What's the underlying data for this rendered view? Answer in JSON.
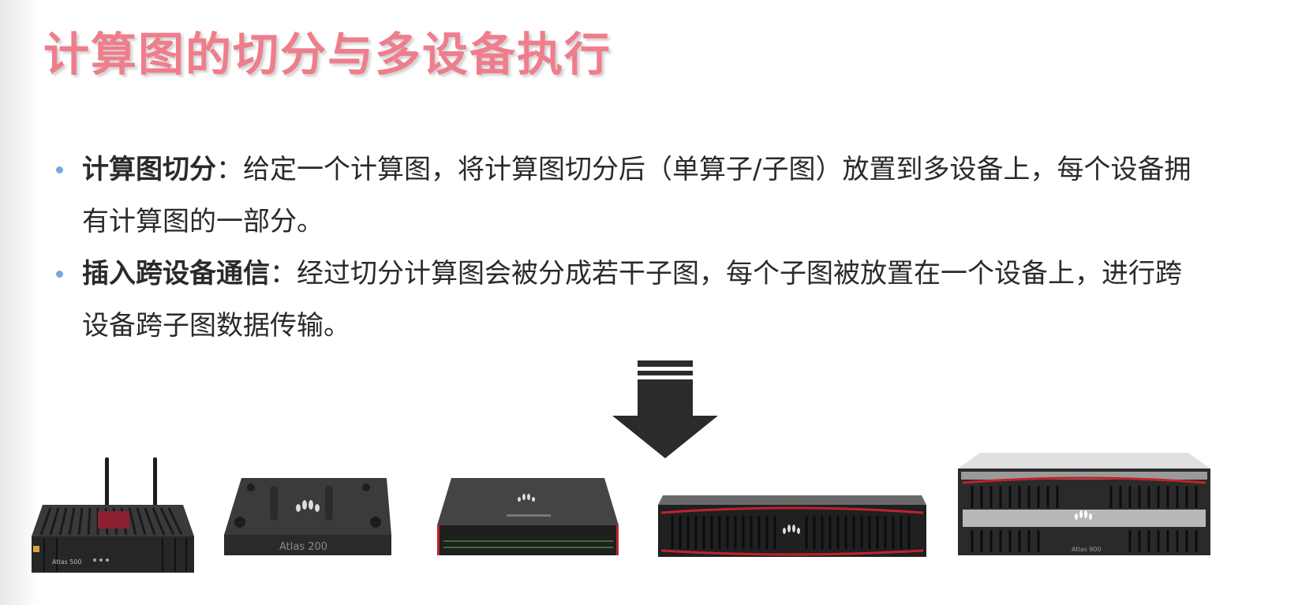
{
  "slide": {
    "title": "计算图的切分与多设备执行",
    "bullets": [
      {
        "term": "计算图切分",
        "sep": "：",
        "line1": "给定一个计算图，将计算图切分后（单算子/子图）放置到多设备上，每个设备拥",
        "line2": "有计算图的一部分。"
      },
      {
        "term": "插入跨设备通信",
        "sep": "：",
        "line1": "经过切分计算图会被分成若干子图，每个子图被放置在一个设备上，进行跨",
        "line2": "设备跨子图数据传输。"
      }
    ],
    "devices": [
      {
        "name": "atlas-500",
        "label": "Atlas 500"
      },
      {
        "name": "atlas-200",
        "label": "Atlas 200"
      },
      {
        "name": "atlas-300",
        "label": ""
      },
      {
        "name": "atlas-800-2u",
        "label": ""
      },
      {
        "name": "atlas-900",
        "label": "Atlas 900"
      }
    ],
    "colors": {
      "title": "#ef7d8c",
      "bullet_dot": "#7aa7e0",
      "arrow": "#2b2b2b",
      "device_accent": "#c0232b"
    }
  }
}
